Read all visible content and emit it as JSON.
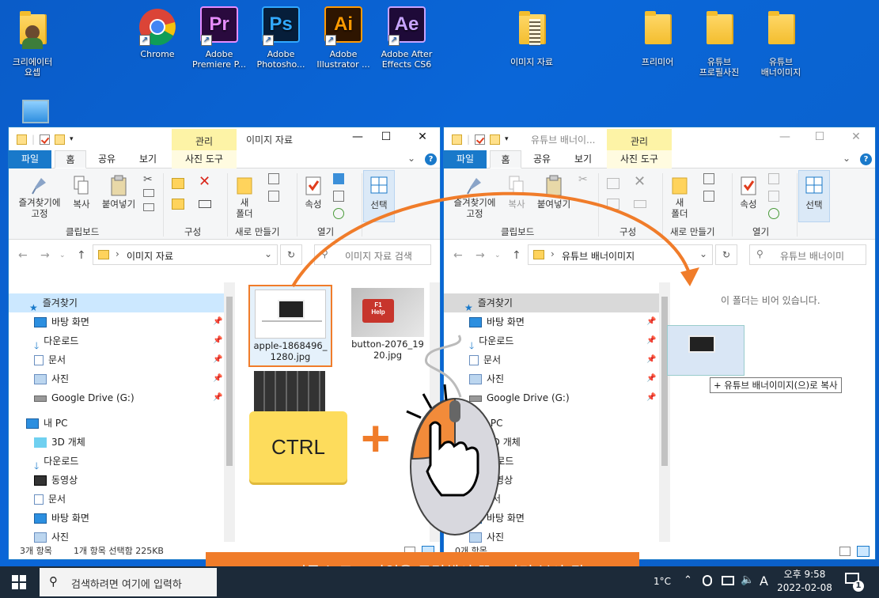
{
  "desktop": {
    "icons": [
      {
        "label": "크리에이터\n요셉"
      },
      {
        "label": "Chrome"
      },
      {
        "label": "Adobe\nPremiere P...",
        "abbr": "Pr"
      },
      {
        "label": "Adobe\nPhotosho...",
        "abbr": "Ps"
      },
      {
        "label": "Adobe\nIllustrator ...",
        "abbr": "Ai"
      },
      {
        "label": "Adobe After\nEffects CS6",
        "abbr": "Ae"
      },
      {
        "label": "이미지 자료"
      },
      {
        "label": "프리미어"
      },
      {
        "label": "유튜브\n프로필사진"
      },
      {
        "label": "유튜브\n배너이미지"
      }
    ]
  },
  "left_window": {
    "manage_tab": "관리",
    "title": "이미지 자료",
    "tabs": [
      "파일",
      "홈",
      "공유",
      "보기",
      "사진 도구"
    ],
    "ribbon": {
      "pin_quick": "즐겨찾기에\n고정",
      "copy": "복사",
      "paste": "붙여넣기",
      "new_folder": "새\n폴더",
      "properties": "속성",
      "select": "선택",
      "groups": [
        "클립보드",
        "구성",
        "새로 만들기",
        "열기"
      ]
    },
    "address": "이미지 자료",
    "search_placeholder": "이미지 자료 검색",
    "nav": [
      "즐겨찾기",
      "바탕 화면",
      "다운로드",
      "문서",
      "사진",
      "Google Drive (G:)",
      "내 PC",
      "3D 개체",
      "다운로드",
      "동영상",
      "문서",
      "바탕 화면",
      "사진"
    ],
    "files": [
      {
        "name": "apple-1868496_\n1280.jpg"
      },
      {
        "name": "button-2076_19\n20.jpg"
      }
    ],
    "status_count": "3개 항목",
    "status_selected": "1개 항목 선택함 225KB"
  },
  "right_window": {
    "manage_tab": "관리",
    "title": "유튜브 배너이...",
    "tabs": [
      "파일",
      "홈",
      "공유",
      "보기",
      "사진 도구"
    ],
    "ribbon": {
      "pin_quick": "즐겨찾기에\n고정",
      "copy": "복사",
      "paste": "붙여넣기",
      "new_folder": "새\n폴더",
      "properties": "속성",
      "select": "선택",
      "groups": [
        "클립보드",
        "구성",
        "새로 만들기",
        "열기"
      ]
    },
    "address": "유튜브 배너이미지",
    "search_placeholder": "유튜브 배너이미",
    "empty_message": "이 폴더는 비어 있습니다.",
    "nav": [
      "즐겨찾기",
      "바탕 화면",
      "다운로드",
      "문서",
      "사진",
      "Google Drive (G:)",
      "내 PC",
      "3D 개체",
      "다운로드",
      "동영상",
      "문서",
      "바탕 화면",
      "사진"
    ],
    "drag_tooltip": "+ 유튜브 배너이미지(으)로 복사",
    "status_count": "0개 항목"
  },
  "overlay": {
    "ctrl_key": "CTRL",
    "plus": "+",
    "caption": "Ctrl 키를 누르고 파일을 클릭해서 끌고가면 복사 됨"
  },
  "taskbar": {
    "search_placeholder": "검색하려면 여기에 입력하",
    "weather": "1°C",
    "ime": "A",
    "time": "오후 9:58",
    "date": "2022-02-08",
    "notif_count": "1"
  },
  "colors": {
    "accent": "#1979ca",
    "overlay_orange": "#f07c2a",
    "ctrl_yellow": "#fddc5c",
    "desktop": "#0a62d0"
  }
}
